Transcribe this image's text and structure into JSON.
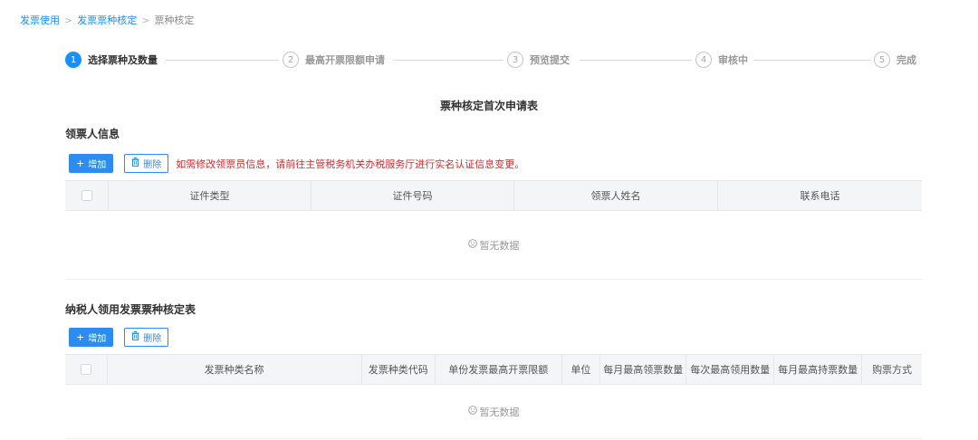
{
  "breadcrumb": {
    "items": [
      "发票使用",
      "发票票种核定",
      "票种核定"
    ],
    "separator": ">"
  },
  "steps": [
    {
      "num": "1",
      "label": "选择票种及数量",
      "active": true
    },
    {
      "num": "2",
      "label": "最高开票限额申请",
      "active": false
    },
    {
      "num": "3",
      "label": "预览提交",
      "active": false
    },
    {
      "num": "4",
      "label": "审核中",
      "active": false
    },
    {
      "num": "5",
      "label": "完成",
      "active": false
    }
  ],
  "form_title": "票种核定首次申请表",
  "section1": {
    "title": "领票人信息",
    "add_label": "增加",
    "delete_label": "删除",
    "warning": "如需修改领票员信息，请前往主管税务机关办税服务厅进行实名认证信息变更。",
    "columns": [
      "证件类型",
      "证件号码",
      "领票人姓名",
      "联系电话"
    ],
    "empty_text": "暂无数据"
  },
  "section2": {
    "title": "纳税人领用发票票种核定表",
    "add_label": "增加",
    "delete_label": "删除",
    "columns": [
      "发票种类名称",
      "发票种类代码",
      "单份发票最高开票限额",
      "单位",
      "每月最高领票数量",
      "每次最高领用数量",
      "每月最高持票数量",
      "购票方式"
    ],
    "empty_text": "暂无数据"
  },
  "icons": {
    "add": "plus-icon",
    "delete": "trash-icon",
    "empty": "empty-face-icon"
  },
  "colors": {
    "primary": "#2d8cf0",
    "link": "#1890ff",
    "warning": "#e0282e"
  }
}
